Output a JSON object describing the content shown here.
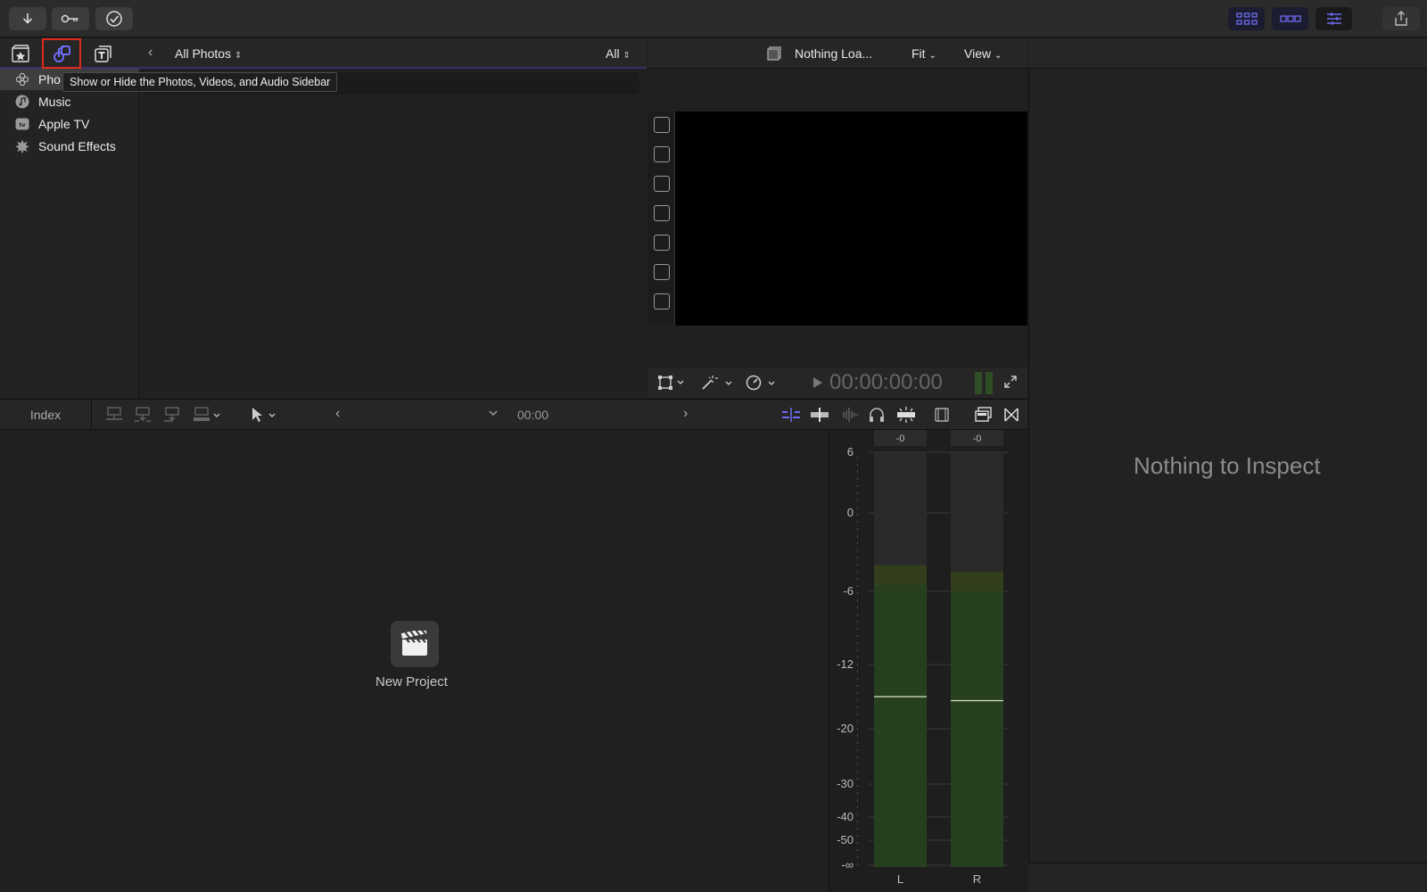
{
  "toolbar": {
    "left_buttons": [
      {
        "name": "import-media-button",
        "icon": "download-arrow-icon"
      },
      {
        "name": "keywords-button",
        "icon": "key-icon"
      },
      {
        "name": "background-tasks-button",
        "icon": "checkmark-circle-icon"
      }
    ],
    "right_buttons": [
      {
        "name": "show-browser-button",
        "icon": "grid-icon"
      },
      {
        "name": "show-timeline-button",
        "icon": "filmstrip-icon"
      },
      {
        "name": "show-inspector-button",
        "icon": "sliders-icon"
      },
      {
        "name": "share-button",
        "icon": "share-icon"
      }
    ]
  },
  "library": {
    "tabs": [
      "libraries-icon",
      "photos-audio-icon",
      "titles-generators-icon"
    ],
    "back_symbol": "‹",
    "source_dropdown": "All Photos",
    "filter_dropdown": "All",
    "tooltip": "Show or Hide the Photos, Videos, and Audio Sidebar",
    "sidebar": [
      {
        "label": "Pho",
        "icon": "photos-icon",
        "selected": true
      },
      {
        "label": "Music",
        "icon": "music-note-icon",
        "selected": false
      },
      {
        "label": "Apple TV",
        "icon": "apple-tv-icon",
        "selected": false
      },
      {
        "label": "Sound Effects",
        "icon": "sound-effects-icon",
        "selected": false
      }
    ]
  },
  "viewer": {
    "clip_name": "Nothing Loa...",
    "zoom": "Fit",
    "view": "View",
    "timecode": "00:00:00:00",
    "checkbox_count": 7
  },
  "inspector": {
    "empty_message": "Nothing to Inspect"
  },
  "timeline": {
    "index_label": "Index",
    "timecode": "00:00",
    "prev_symbol": "‹",
    "next_symbol": "›",
    "new_project_label": "New Project"
  },
  "audio_meters": {
    "scale": [
      "6",
      "0",
      "-6",
      "-12",
      "-20",
      "-30",
      "-40",
      "-50",
      "-∞"
    ],
    "channels": [
      {
        "label": "L",
        "peak": "-0",
        "level_db": -4,
        "peak_hold_db": -16
      },
      {
        "label": "R",
        "peak": "-0",
        "level_db": -4.5,
        "peak_hold_db": -16.5
      }
    ]
  },
  "colors": {
    "accent": "#5e5ce6",
    "highlight": "#e0291d",
    "meter_green": "#26401f"
  }
}
